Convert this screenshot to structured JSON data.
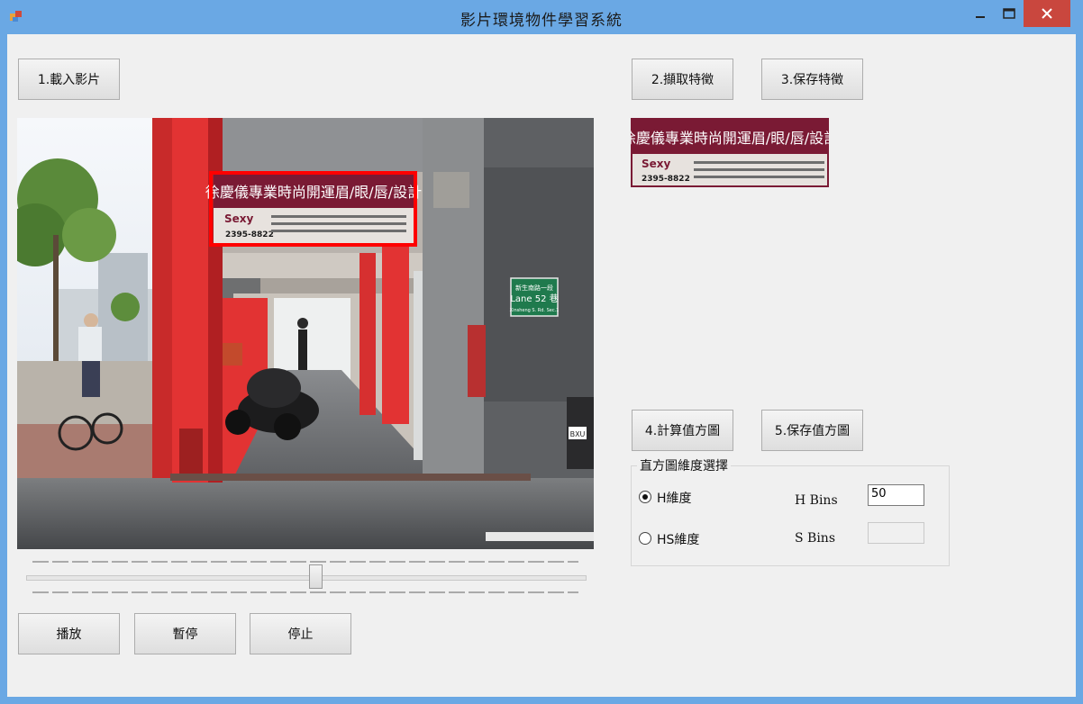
{
  "window": {
    "title": "影片環境物件學習系統"
  },
  "buttons": {
    "load_video": "1.載入影片",
    "extract_features": "2.擷取特徵",
    "save_features": "3.保存特徵",
    "compute_histogram": "4.計算值方圖",
    "save_histogram": "5.保存值方圖",
    "play": "播放",
    "pause": "暫停",
    "stop": "停止"
  },
  "video_frame": {
    "sign_title": "徐慶儀專業時尚開運眉/眼/唇/設計",
    "sign_brand": "Sexy",
    "sign_phone": "2395-8822",
    "street_sign_line1": "新生南路一段",
    "street_sign_line2": "Lane 52 巷",
    "street_sign_line3": "Xinsheng S. Rd. Sec.1",
    "scooter_plate": "BXU"
  },
  "feature_preview": {
    "sign_title": "徐慶儀專業時尚開運眉/眼/唇/設計",
    "sign_brand": "Sexy",
    "sign_phone": "2395-8822"
  },
  "histogram_group": {
    "legend": "直方圖維度選擇",
    "option_h": "H維度",
    "option_hs": "HS維度",
    "selected": "H維度",
    "h_bins_label": "H Bins",
    "h_bins_value": "50",
    "s_bins_label": "S Bins",
    "s_bins_value": ""
  },
  "slider": {
    "position_fraction": 0.5
  },
  "colors": {
    "title_bar": "#6aa8e4",
    "close_button": "#c9473e",
    "client_bg": "#f0f0f0",
    "selection_box": "#ff0000"
  }
}
